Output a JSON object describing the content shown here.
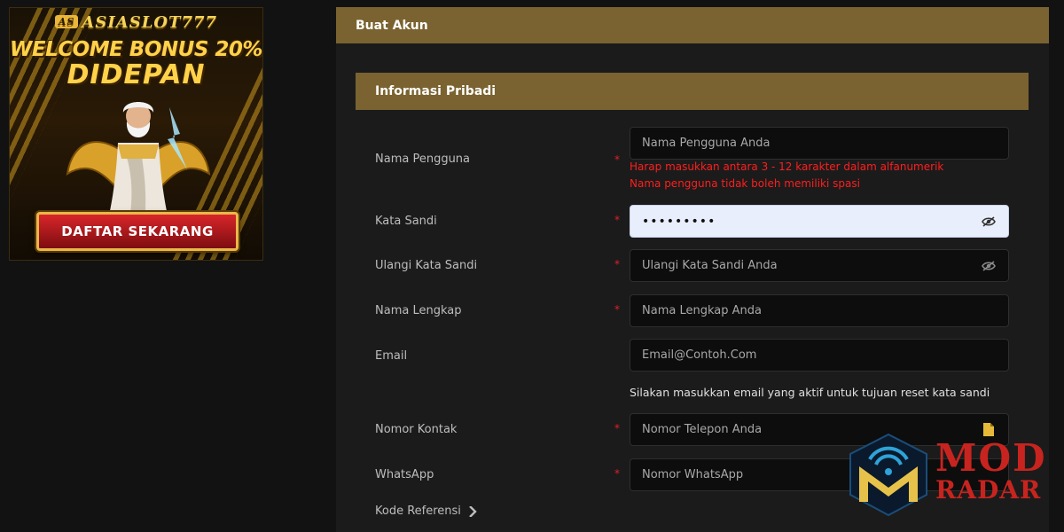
{
  "banner": {
    "brand_prefix": "AS",
    "brand": "ASIASLOT777",
    "promo_line1": "WELCOME BONUS 20%",
    "promo_line2": "DIDEPAN",
    "cta": "DAFTAR SEKARANG"
  },
  "header": {
    "title": "Buat Akun"
  },
  "section": {
    "title": "Informasi Pribadi"
  },
  "form": {
    "required_mark": "*",
    "username": {
      "label": "Nama Pengguna",
      "placeholder": "Nama Pengguna Anda",
      "error1": "Harap masukkan antara 3 - 12 karakter dalam alfanumerik",
      "error2": "Nama pengguna tidak boleh memiliki spasi"
    },
    "password": {
      "label": "Kata Sandi",
      "value": "•••••••••"
    },
    "confirm_password": {
      "label": "Ulangi Kata Sandi",
      "placeholder": "Ulangi Kata Sandi Anda"
    },
    "full_name": {
      "label": "Nama Lengkap",
      "placeholder": "Nama Lengkap Anda"
    },
    "email": {
      "label": "Email",
      "placeholder": "Email@Contoh.Com",
      "hint": "Silakan masukkan email yang aktif untuk tujuan reset kata sandi"
    },
    "phone": {
      "label": "Nomor Kontak",
      "placeholder": "Nomor Telepon Anda"
    },
    "whatsapp": {
      "label": "WhatsApp",
      "placeholder": "Nomor WhatsApp"
    },
    "referral": {
      "label": "Kode Referensi"
    }
  },
  "watermark": {
    "line1": "MOD",
    "line2": "RADAR"
  },
  "icons": {
    "password_toggle": "eye-slash-icon",
    "phone_field": "document-icon",
    "referral_toggle": "chevron-right-icon"
  },
  "colors": {
    "header_gold": "#7a6330",
    "error_red": "#ff1e1e",
    "background": "#121212"
  }
}
